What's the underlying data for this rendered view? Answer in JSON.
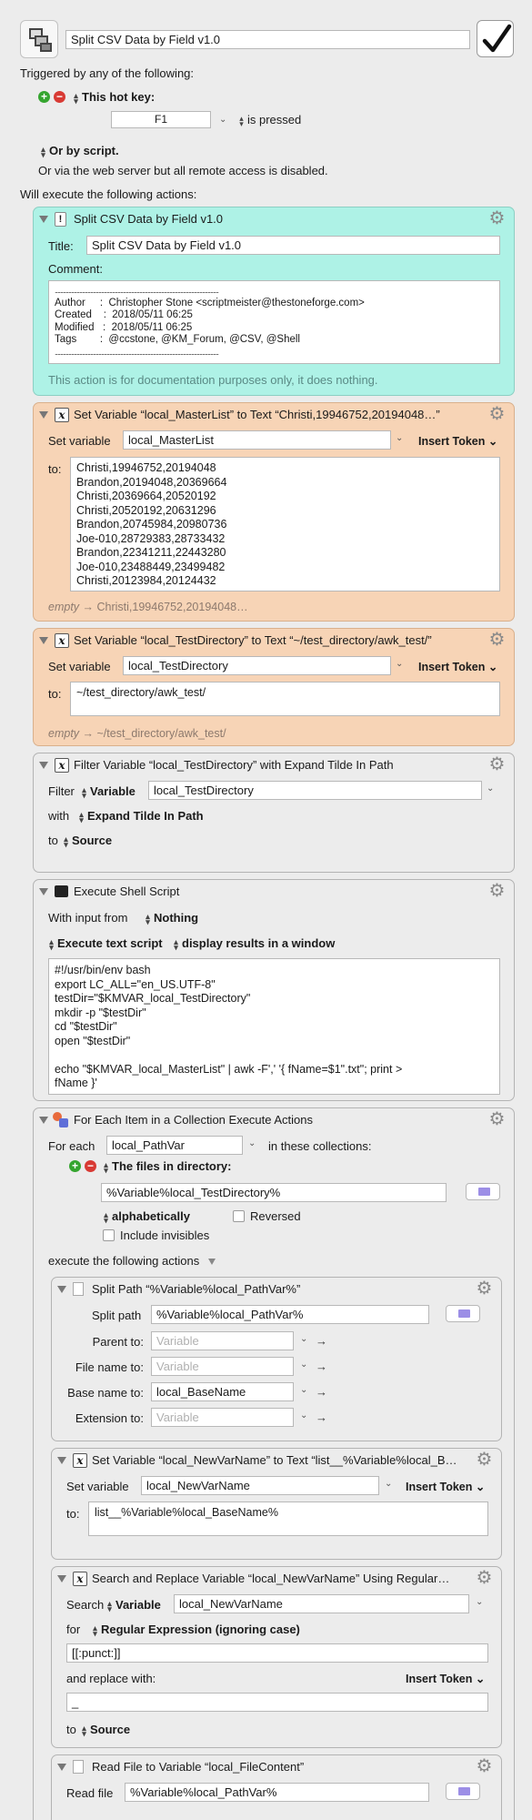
{
  "macro": {
    "name": "Split CSV Data by Field v1.0",
    "enabled": true
  },
  "trigger": {
    "header": "Triggered by any of the following:",
    "hotkey_label": "This hot key:",
    "hotkey_value": "F1",
    "hotkey_mode": "is pressed",
    "script_label": "Or by script.",
    "webserver_text": "Or via the web server but all remote access is disabled.",
    "execute_header": "Will execute the following actions:"
  },
  "comment_action": {
    "title": "Split CSV Data by Field v1.0",
    "title_label": "Title:",
    "title_value": "Split CSV Data by Field v1.0",
    "comment_label": "Comment:",
    "comment_lines": [
      "........................................................................................................................",
      "Author     :  Christopher Stone <scriptmeister@thestoneforge.com>",
      "Created    :  2018/05/11 06:25",
      "Modified   :  2018/05/11 06:25",
      "Tags        :  @ccstone, @KM_Forum, @CSV, @Shell",
      "........................................................................................................................"
    ],
    "note": "This action is for documentation purposes only, it does nothing."
  },
  "set_master": {
    "title": "Set Variable “local_MasterList” to Text “Christi,19946752,20194048…”",
    "setvar_label": "Set variable",
    "var_value": "local_MasterList",
    "insert_token": "Insert Token",
    "to_label": "to:",
    "text_lines": [
      "Christi,19946752,20194048",
      "Brandon,20194048,20369664",
      "Christi,20369664,20520192",
      "Christi,20520192,20631296",
      "Brandon,20745984,20980736",
      "Joe-010,28729383,28733432",
      "Brandon,22341211,22443280",
      "Joe-010,23488449,23499482",
      "Christi,20123984,20124432"
    ],
    "empty_prefix": "empty",
    "empty_value": "Christi,19946752,20194048…"
  },
  "set_testdir": {
    "title": "Set Variable “local_TestDirectory” to Text “~/test_directory/awk_test/”",
    "setvar_label": "Set variable",
    "var_value": "local_TestDirectory",
    "insert_token": "Insert Token",
    "to_label": "to:",
    "text_value": "~/test_directory/awk_test/",
    "empty_prefix": "empty",
    "empty_value": "~/test_directory/awk_test/"
  },
  "filter": {
    "title": "Filter Variable “local_TestDirectory” with Expand Tilde In Path",
    "filter_label": "Filter",
    "filter_type": "Variable",
    "var_value": "local_TestDirectory",
    "with_label": "with",
    "with_value": "Expand Tilde In Path",
    "to_label": "to",
    "to_value": "Source"
  },
  "shell": {
    "title": "Execute Shell Script",
    "input_label": "With input from",
    "input_value": "Nothing",
    "mode": "Execute text script",
    "display": "display results in a window",
    "script_lines": [
      "#!/usr/bin/env bash",
      "export LC_ALL=\"en_US.UTF-8\"",
      "testDir=\"$KMVAR_local_TestDirectory\"",
      "mkdir -p \"$testDir\"",
      "cd \"$testDir\"",
      "open \"$testDir\"",
      "",
      "echo \"$KMVAR_local_MasterList\" | awk -F',' '{ fName=$1\".txt\"; print >",
      "fName }'"
    ]
  },
  "foreach": {
    "title": "For Each Item in a Collection Execute Actions",
    "foreach_label": "For each",
    "var_value": "local_PathVar",
    "collections_label": "in these collections:",
    "collection_type": "The files in directory:",
    "dir_value": "%Variable%local_TestDirectory%",
    "sort_value": "alphabetically",
    "reversed_label": "Reversed",
    "invisibles_label": "Include invisibles",
    "execute_label": "execute the following actions"
  },
  "split_path": {
    "title": "Split Path “%Variable%local_PathVar%”",
    "split_label": "Split path",
    "split_value": "%Variable%local_PathVar%",
    "parent_label": "Parent to:",
    "parent_placeholder": "Variable",
    "filename_label": "File name to:",
    "filename_placeholder": "Variable",
    "basename_label": "Base name to:",
    "basename_value": "local_BaseName",
    "extension_label": "Extension to:",
    "extension_placeholder": "Variable"
  },
  "set_newvar": {
    "title": "Set Variable “local_NewVarName” to Text “list__%Variable%local_B…",
    "setvar_label": "Set variable",
    "var_value": "local_NewVarName",
    "insert_token": "Insert Token",
    "to_label": "to:",
    "text_value": "list__%Variable%local_BaseName%"
  },
  "search_replace": {
    "title": "Search and Replace Variable “local_NewVarName” Using Regular…",
    "search_label": "Search",
    "search_type": "Variable",
    "var_value": "local_NewVarName",
    "for_label": "for",
    "for_value": "Regular Expression (ignoring case)",
    "pattern_value": "[[:punct:]]",
    "replace_label": "and replace with:",
    "insert_token": "Insert Token",
    "replace_value": "_",
    "to_label": "to",
    "to_value": "Source"
  },
  "read_file": {
    "title": "Read File to Variable “local_FileContent”",
    "read_label": "Read file",
    "read_value": "%Variable%local_PathVar%"
  }
}
